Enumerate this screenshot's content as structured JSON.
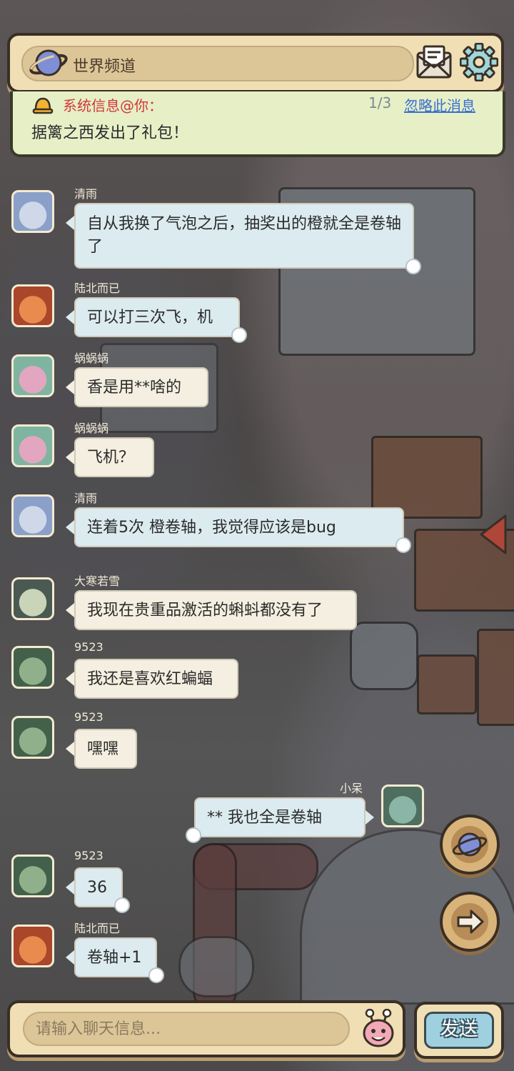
{
  "header": {
    "channel_title": "世界频道",
    "icons": {
      "channel": "planet-icon",
      "mail": "mail-icon",
      "settings": "gear-icon"
    }
  },
  "notice": {
    "title": "系统信息@你：",
    "count": "1/3",
    "ignore_label": "忽略此消息",
    "text": "据篱之西发出了礼包！"
  },
  "messages": [
    {
      "user": "清雨",
      "text": "自从我换了气泡之后，抽奖出的橙就全是卷轴了",
      "style": "blue",
      "side": "left"
    },
    {
      "user": "陆北而已",
      "text": "可以打三次飞，机",
      "style": "blue",
      "side": "left"
    },
    {
      "user": "蜗蜗蜗",
      "text": "香是用**啥的",
      "style": "cream",
      "side": "left"
    },
    {
      "user": "蜗蜗蜗",
      "text": "飞机？",
      "style": "cream",
      "side": "left"
    },
    {
      "user": "清雨",
      "text": "连着5次  橙卷轴，我觉得应该是bug",
      "style": "blue",
      "side": "left"
    },
    {
      "user": "大寒若雪",
      "text": "我现在贵重品激活的蝌蚪都没有了",
      "style": "cream",
      "side": "left"
    },
    {
      "user": "9523",
      "text": "我还是喜欢红蝙蝠",
      "style": "cream",
      "side": "left"
    },
    {
      "user": "9523",
      "text": "嘿嘿",
      "style": "cream",
      "side": "left"
    },
    {
      "user": "小呆",
      "text": "**    我也全是卷轴",
      "style": "blue",
      "side": "right"
    },
    {
      "user": "9523",
      "text": "36",
      "style": "blue",
      "side": "left"
    },
    {
      "user": "陆北而已",
      "text": "卷轴+1",
      "style": "blue",
      "side": "left"
    }
  ],
  "input": {
    "placeholder": "请输入聊天信息..."
  },
  "send_label": "发送",
  "colors": {
    "accent": "#d2383a",
    "link": "#3b6fcf",
    "panel": "#f0dfb4"
  }
}
